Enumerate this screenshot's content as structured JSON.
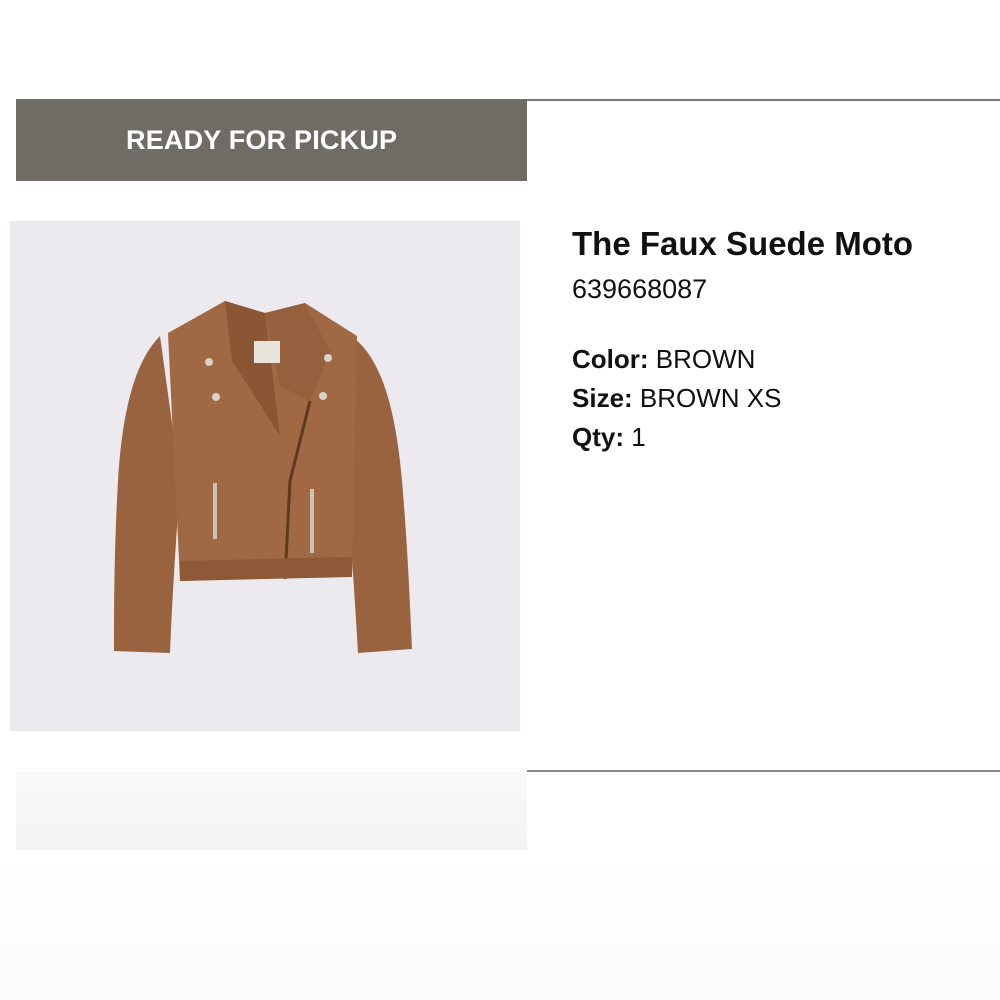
{
  "order_item": {
    "status": "READY FOR PICKUP",
    "product": {
      "name": "The Faux Suede Moto",
      "sku": "639668087",
      "image_alt": "brown faux suede moto jacket"
    },
    "attributes": [
      {
        "label": "Color:",
        "value": "BROWN"
      },
      {
        "label": "Size:",
        "value": "BROWN XS"
      },
      {
        "label": "Qty:",
        "value": "1"
      }
    ]
  },
  "colors": {
    "banner": "#6f6c66",
    "jacket": "#9a6440",
    "image_background": "#eceaef"
  },
  "icons": {
    "product_image": "jacket-image"
  }
}
